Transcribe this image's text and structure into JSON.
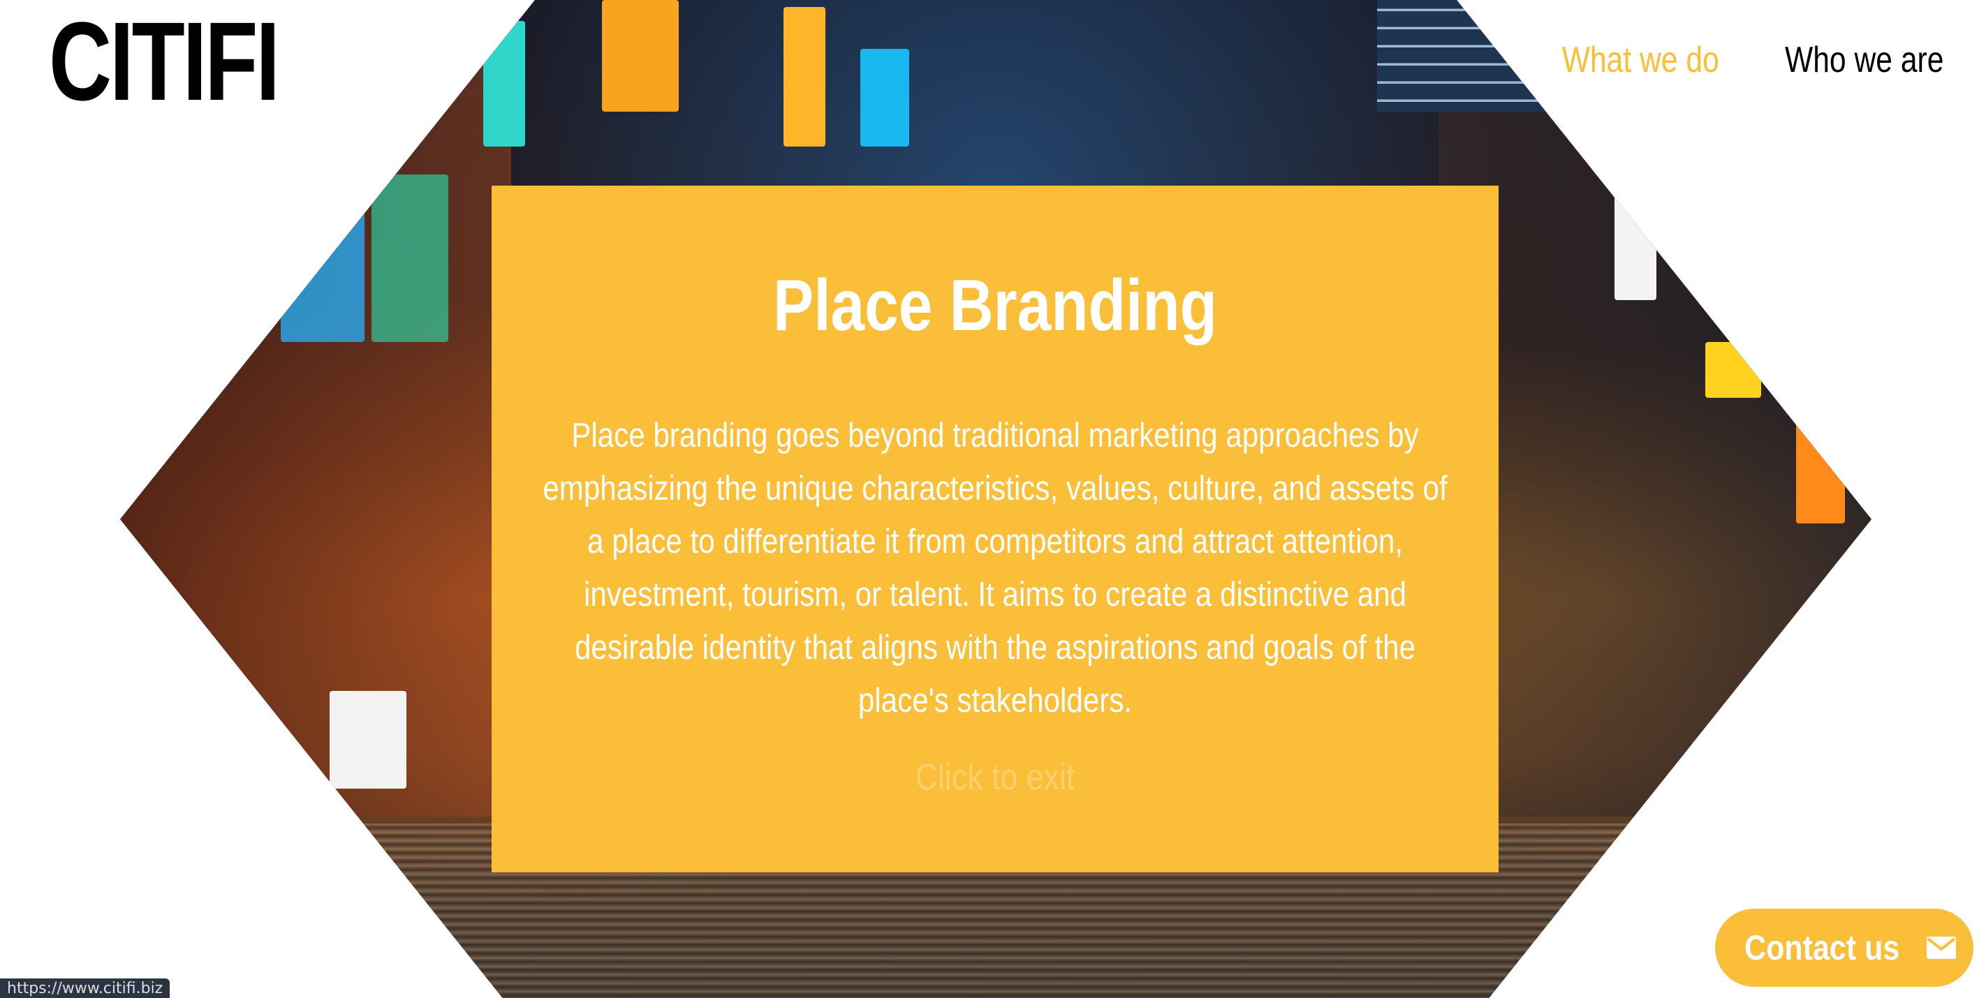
{
  "brand": {
    "logo_text": "CITIFI"
  },
  "nav": {
    "items": [
      {
        "label": "What we do",
        "active": true
      },
      {
        "label": "Who we are",
        "active": false
      }
    ],
    "active_color": "#fbbe35",
    "text_color": "#000000"
  },
  "hero": {
    "image_description_icon": "city-night-street-photo"
  },
  "modal": {
    "title": "Place Branding",
    "body": "Place branding goes beyond traditional marketing approaches by emphasizing the unique characteristics, values, culture, and assets of a place to differentiate it from competitors and attract attention, investment, tourism, or talent. It aims to create a distinctive and desirable identity that aligns with the aspirations and goals of the place's stakeholders.",
    "exit_label": "Click to exit",
    "background_color": "#fbbe39"
  },
  "contact": {
    "label": "Contact us",
    "icon": "envelope-icon"
  },
  "status_bar": {
    "url": "https://www.citifi.biz"
  }
}
